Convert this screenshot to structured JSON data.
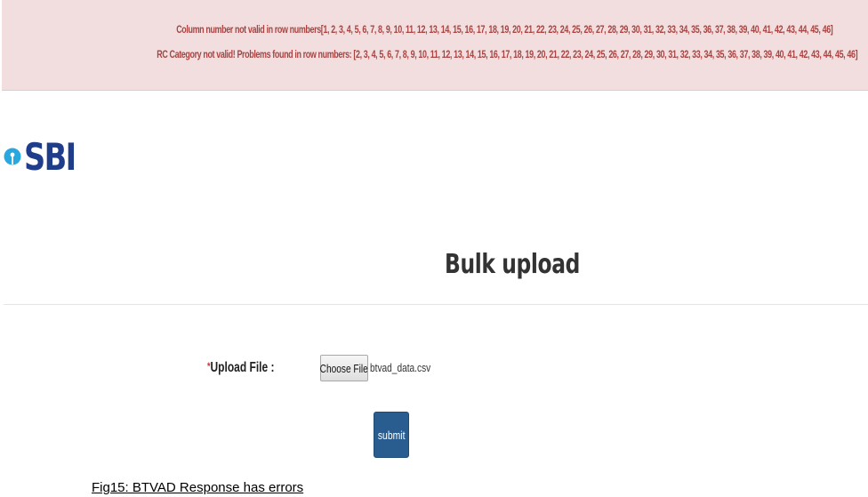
{
  "alert": {
    "line1": "Column number not valid in row numbers[1, 2, 3, 4, 5, 6, 7, 8, 9, 10, 11, 12, 13, 14, 15, 16, 17, 18, 19, 20, 21, 22, 23, 24, 25, 26, 27, 28, 29, 30, 31, 32, 33, 34, 35, 36, 37, 38, 39, 40, 41, 42, 43, 44, 45, 46]",
    "line2": "RC Category not valid! Problems found in row numbers: [2, 3, 4, 5, 6, 7, 8, 9, 10, 11, 12, 13, 14, 15, 16, 17, 18, 19, 20, 21, 22, 23, 24, 25, 26, 27, 28, 29, 30, 31, 32, 33, 34, 35, 36, 37, 38, 39, 40, 41, 42, 43, 44, 45, 46]",
    "background_color": "#f2dede",
    "text_color": "#a94442"
  },
  "brand": {
    "logo_text": "SBI",
    "logo_icon": "sbi-keyhole-icon",
    "color": "#1f3d8a"
  },
  "page": {
    "title": "Bulk upload"
  },
  "form": {
    "required_mark": "*",
    "upload_label": "Upload File :",
    "choose_button_label": "Choose File",
    "selected_file": "btvad_data.csv",
    "submit_label": "submit",
    "submit_color": "#2a5d8f"
  },
  "caption": "Fig15: BTVAD Response has errors"
}
